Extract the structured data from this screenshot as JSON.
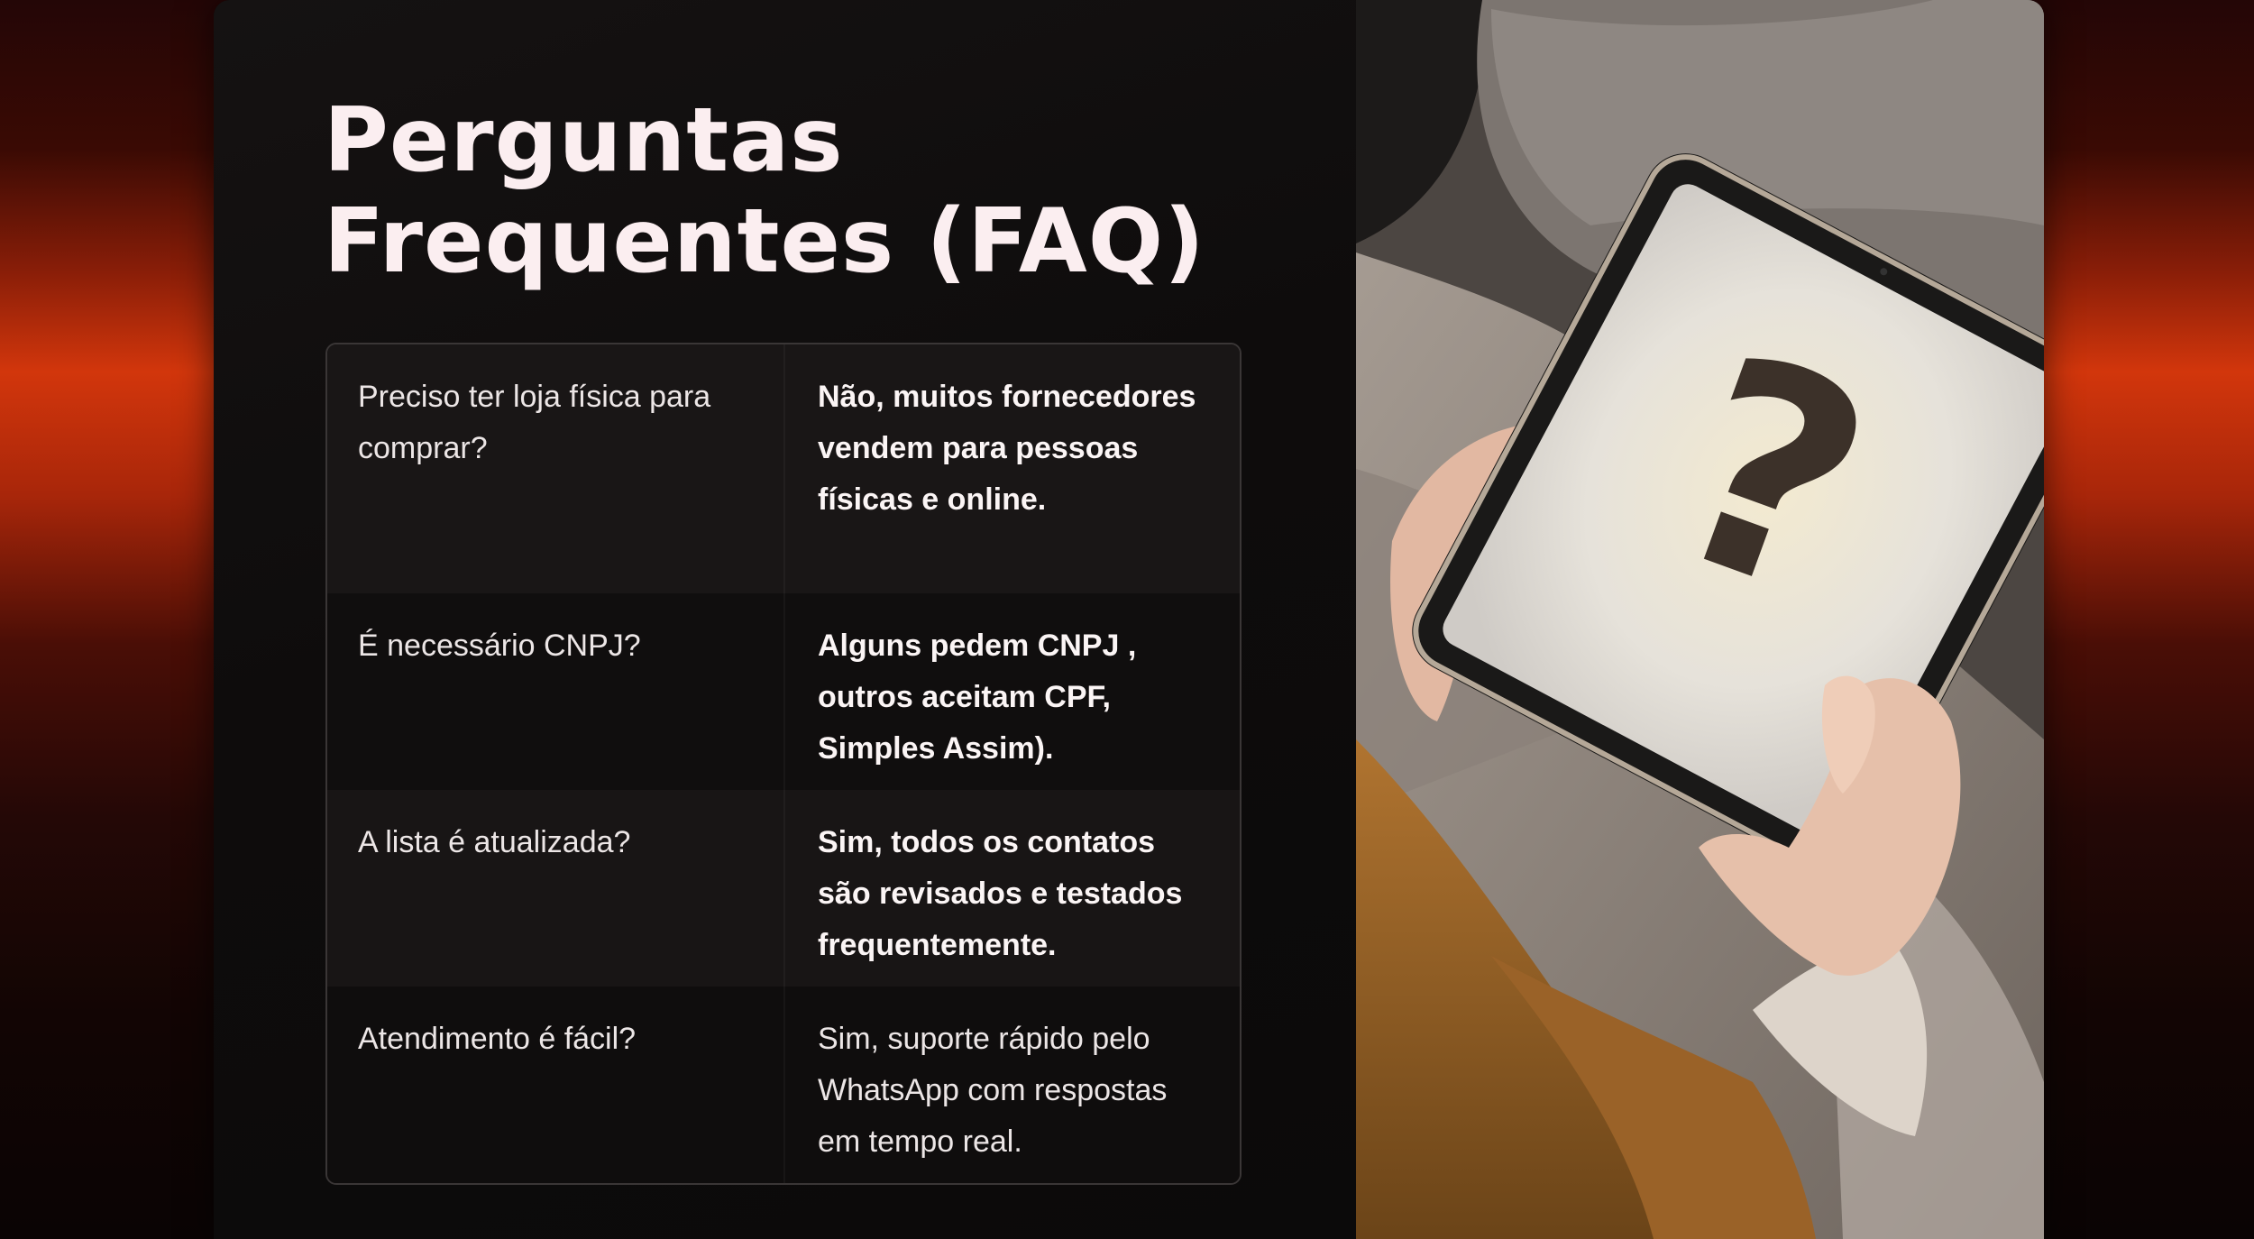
{
  "title": {
    "line1": "Perguntas",
    "line2": "Frequentes (FAQ)"
  },
  "faq": [
    {
      "question": "Preciso ter loja física para comprar?",
      "answer": "Não, muitos fornecedores vendem para pessoas físicas e online."
    },
    {
      "question": "É necessário CNPJ?",
      "answer": "Alguns pedem CNPJ , outros aceitam CPF, Simples Assim)."
    },
    {
      "question": "A lista é atualizada?",
      "answer": "Sim, todos os contatos são revisados e testados frequentemente."
    },
    {
      "question": "Atendimento é fácil?",
      "answer": "Sim, suporte rápido pelo WhatsApp com respostas em tempo real."
    }
  ],
  "photo": {
    "screen_glyph": "?",
    "icon": "question-mark-icon"
  }
}
